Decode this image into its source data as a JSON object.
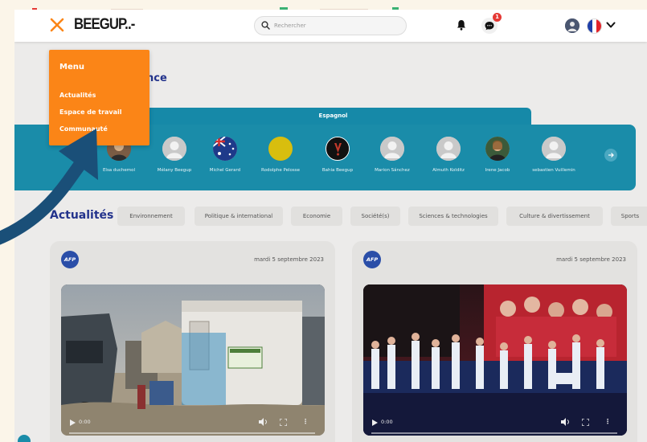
{
  "topbar": {
    "logo": "BEEGUP..-",
    "search_placeholder": "Rechercher",
    "notification_count": "1",
    "language": "fr"
  },
  "menu": {
    "title": "Menu",
    "items": [
      {
        "label": "Actualités"
      },
      {
        "label": "Espace de travail"
      },
      {
        "label": "Communauté"
      }
    ]
  },
  "section": {
    "title_visible": "nce"
  },
  "language_tab": "Espagnol",
  "people": [
    {
      "name": "Elsa duchemol",
      "avatar": "photo"
    },
    {
      "name": "Mélany Beegup",
      "avatar": "default"
    },
    {
      "name": "Michel Gerard",
      "avatar": "australia-flag"
    },
    {
      "name": "Rodolphe Pelosse",
      "avatar": "yellow"
    },
    {
      "name": "Bahia Beegup",
      "avatar": "logo"
    },
    {
      "name": "Marion Sánchez",
      "avatar": "default"
    },
    {
      "name": "Almuth Kolditz",
      "avatar": "default"
    },
    {
      "name": "Irene Jacob",
      "avatar": "photo"
    },
    {
      "name": "sebastien Vuillemin",
      "avatar": "default"
    }
  ],
  "news": {
    "title": "Actualités",
    "categories": [
      "Environnement",
      "Politique & international",
      "Economie",
      "Société(s)",
      "Sciences & technologies",
      "Culture & divertissement",
      "Sports"
    ],
    "cards": [
      {
        "source": "AFP",
        "date": "mardi 5 septembre 2023",
        "video_time": "0:00",
        "scene": "camp"
      },
      {
        "source": "AFP",
        "date": "mardi 5 septembre 2023",
        "video_time": "0:00",
        "scene": "stage"
      }
    ]
  },
  "colors": {
    "accent_orange": "#fb8517",
    "teal": "#1a8ca9",
    "navy": "#23338c",
    "arrow": "#1a4f78"
  }
}
